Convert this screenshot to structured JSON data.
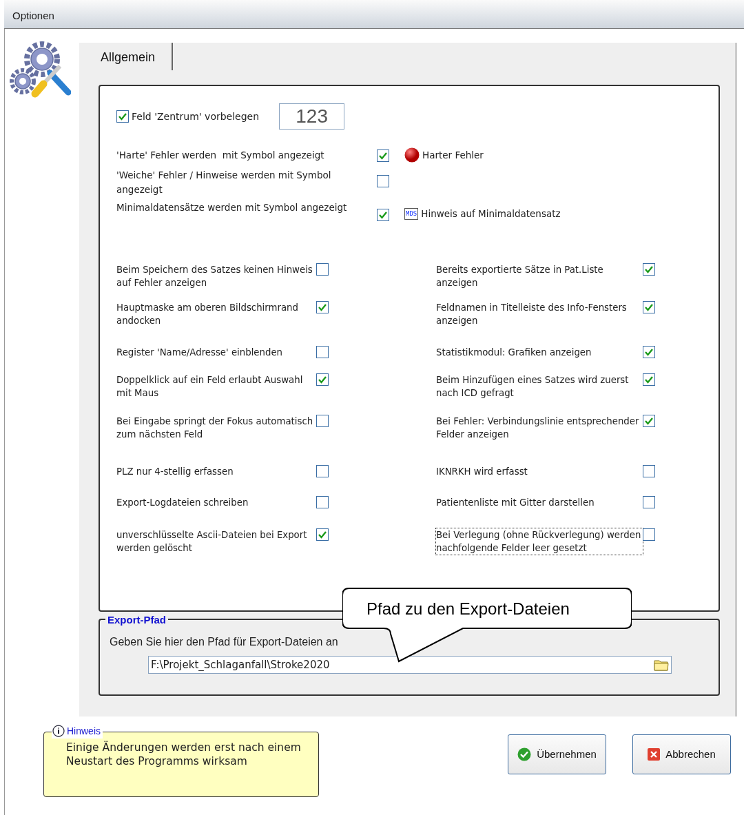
{
  "window": {
    "title": "Optionen"
  },
  "tabs": [
    {
      "label": "Allgemein",
      "selected": true
    }
  ],
  "zentrum": {
    "label": "Feld 'Zentrum' vorbelegen",
    "checked": true,
    "value": "123"
  },
  "symbol_options": [
    {
      "label": "'Harte' Fehler werden  mit Symbol angezeigt",
      "checked": true,
      "kind": "dot",
      "legend": "Harter Fehler"
    },
    {
      "label": "'Weiche' Fehler / Hinweise werden mit Symbol angezeigt",
      "checked": false,
      "kind": "plain"
    },
    {
      "label": "Minimaldatensätze werden mit Symbol angezeigt",
      "checked": true,
      "kind": "mds",
      "badge": "MDS",
      "legend": "Hinweis auf Minimaldatensatz"
    }
  ],
  "options_left": [
    {
      "label": "Beim Speichern des Satzes keinen Hinweis auf Fehler anzeigen",
      "checked": false
    },
    {
      "label": "Hauptmaske am oberen Bildschirmrand andocken",
      "checked": true
    },
    {
      "label": "Register 'Name/Adresse' einblenden",
      "checked": false
    },
    {
      "label": "Doppelklick auf ein Feld erlaubt Auswahl mit Maus",
      "checked": true
    },
    {
      "label": "Bei Eingabe springt der Fokus automatisch zum nächsten Feld",
      "checked": false
    },
    {
      "label": "PLZ nur 4-stellig erfassen",
      "checked": false
    },
    {
      "label": "Export-Logdateien schreiben",
      "checked": false
    },
    {
      "label": "unverschlüsselte Ascii-Dateien bei Export werden gelöscht",
      "checked": true
    }
  ],
  "options_right": [
    {
      "label": "Bereits exportierte Sätze in Pat.Liste anzeigen",
      "checked": true,
      "focused": false
    },
    {
      "label": "Feldnamen in Titelleiste des Info-Fensters anzeigen",
      "checked": true,
      "focused": false
    },
    {
      "label": "Statistikmodul: Grafiken anzeigen",
      "checked": true,
      "focused": false
    },
    {
      "label": "Beim Hinzufügen eines Satzes wird zuerst nach ICD gefragt",
      "checked": true,
      "focused": false
    },
    {
      "label": "Bei Fehler: Verbindungslinie entsprechender Felder anzeigen",
      "checked": true,
      "focused": false
    },
    {
      "label": "IKNRKH wird erfasst",
      "checked": false,
      "focused": false
    },
    {
      "label": "Patientenliste mit Gitter darstellen",
      "checked": false,
      "focused": false
    },
    {
      "label": "Bei Verlegung (ohne Rückverlegung) werden nachfolgende Felder leer gesetzt",
      "checked": false,
      "focused": true
    }
  ],
  "export": {
    "legend": "Export-Pfad",
    "hint": "Geben Sie hier den Pfad für Export-Dateien an",
    "path": "F:\\Projekt_Schlaganfall\\Stroke2020"
  },
  "callout": "Pfad zu den Export-Dateien",
  "notice": {
    "legend": "Hinweis",
    "text": "Einige Änderungen werden erst nach einem Neustart des Programms wirksam"
  },
  "buttons": [
    {
      "label": "Übernehmen",
      "kind": "ok"
    },
    {
      "label": "Abbrechen",
      "kind": "cancel"
    }
  ]
}
